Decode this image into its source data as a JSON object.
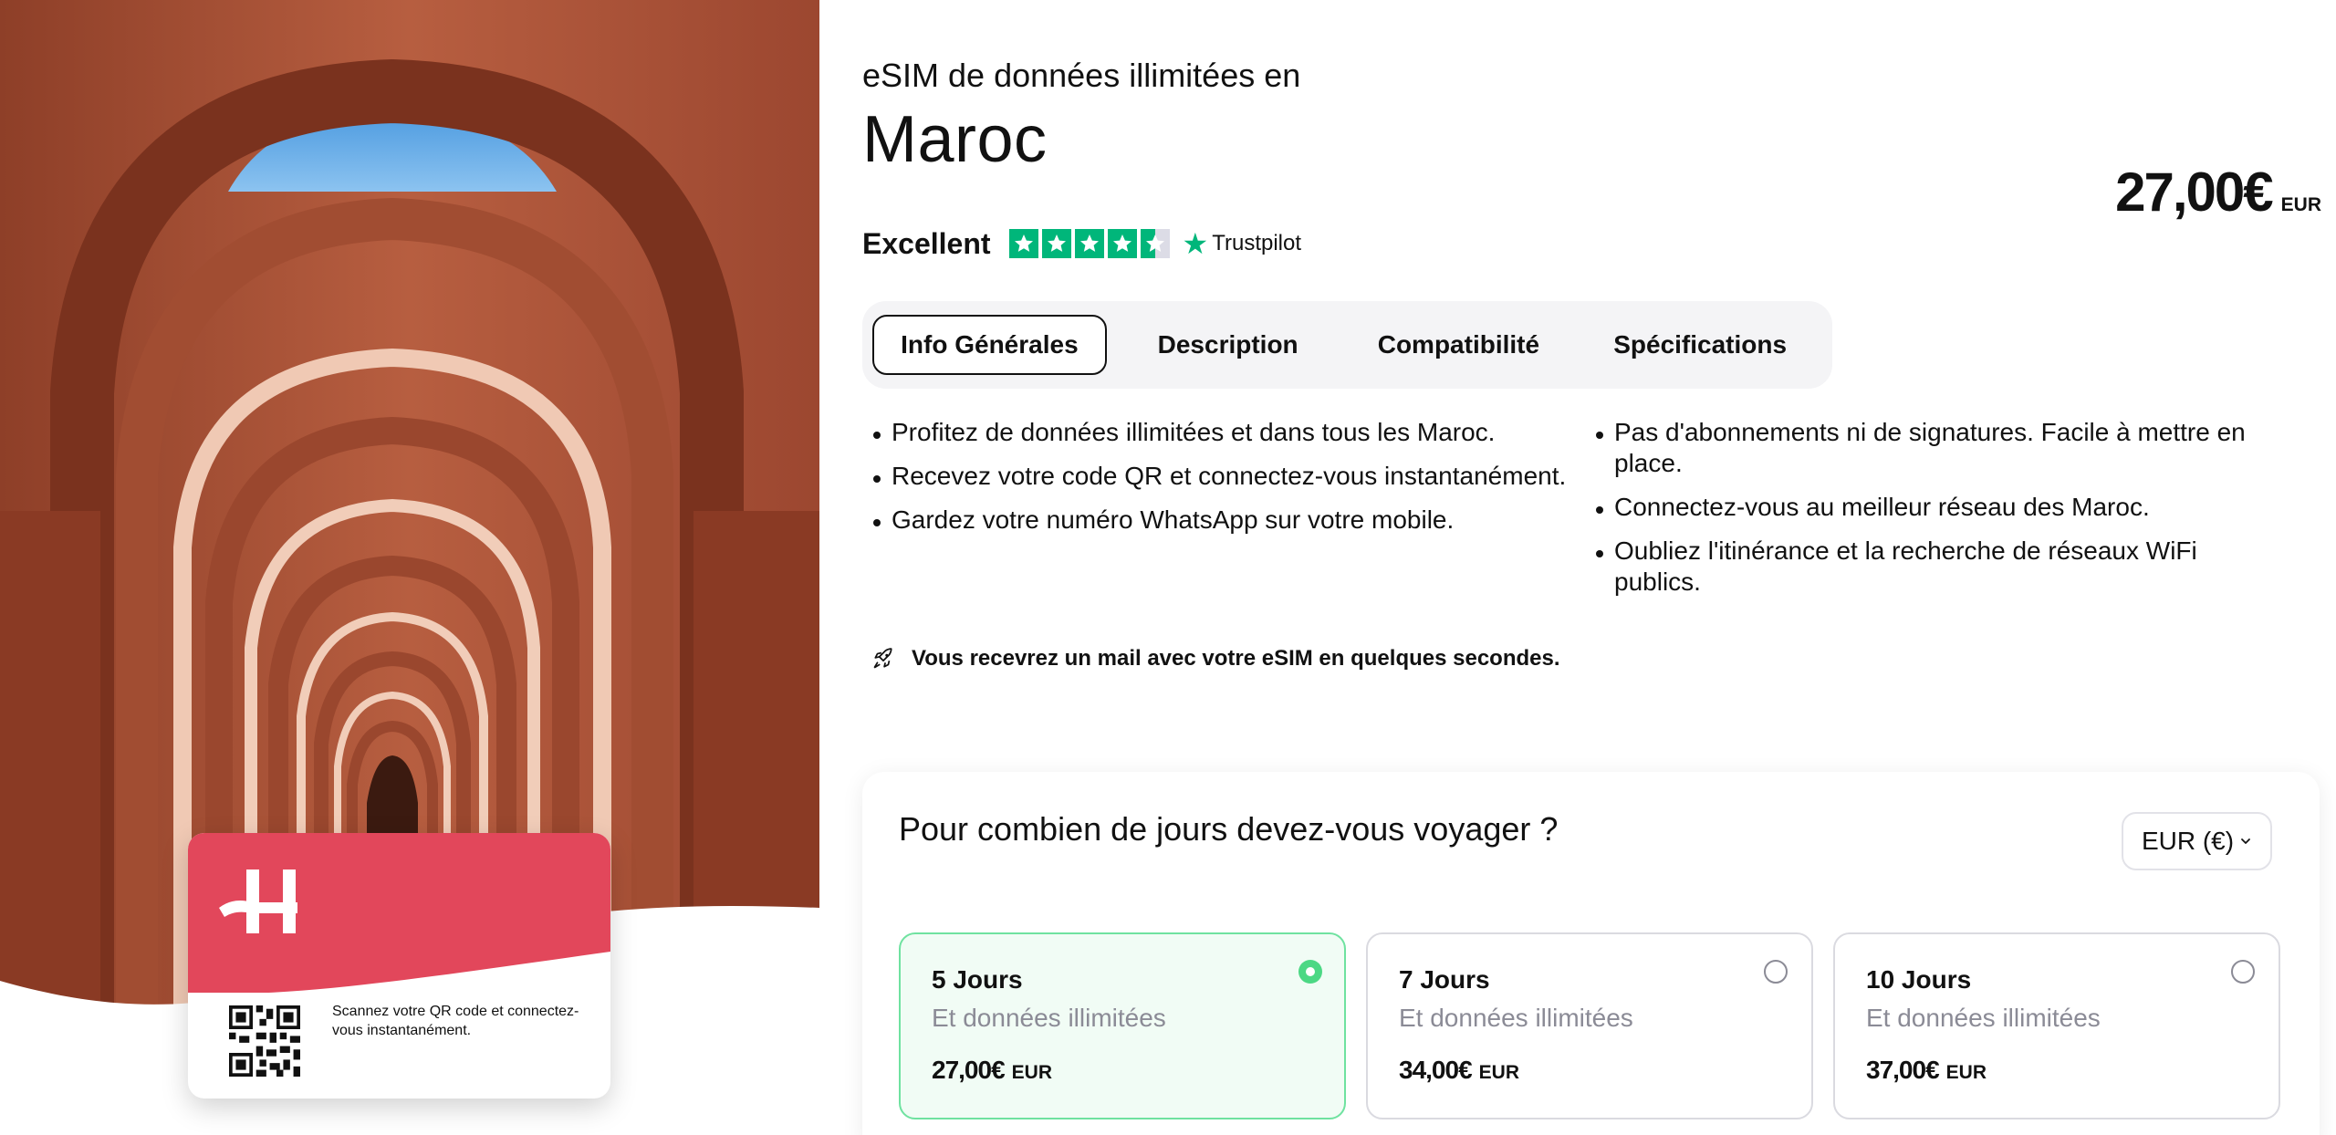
{
  "product": {
    "subtitle": "eSIM de données illimitées en",
    "title": "Maroc",
    "price": {
      "amount": "27,00€",
      "currency": "EUR"
    }
  },
  "rating": {
    "label": "Excellent",
    "stars": 4.5,
    "provider": "Trustpilot",
    "color": "#00b67a"
  },
  "tabs": [
    {
      "label": "Info Générales",
      "active": true
    },
    {
      "label": "Description",
      "active": false
    },
    {
      "label": "Compatibilité",
      "active": false
    },
    {
      "label": "Spécifications",
      "active": false
    }
  ],
  "features": {
    "left": [
      "Profitez de données illimitées et dans tous les Maroc.",
      "Recevez votre code QR et connectez-vous instantanément.",
      "Gardez votre numéro WhatsApp sur votre mobile."
    ],
    "right": [
      "Pas d'abonnements ni de signatures. Facile à mettre en place.",
      "Connectez-vous au meilleur réseau des Maroc.",
      "Oubliez l'itinérance et la recherche de réseaux WiFi publics."
    ]
  },
  "notice": {
    "icon": "rocket-icon",
    "text": "Vous recevrez un mail avec votre eSIM en quelques secondes."
  },
  "duration": {
    "question": "Pour combien de jours devez-vous voyager ?",
    "currency_select": "EUR (€)",
    "plans": [
      {
        "name": "5 Jours",
        "desc": "Et données illimitées",
        "price": "27,00€",
        "currency": "EUR",
        "selected": true
      },
      {
        "name": "7 Jours",
        "desc": "Et données illimitées",
        "price": "34,00€",
        "currency": "EUR",
        "selected": false
      },
      {
        "name": "10 Jours",
        "desc": "Et données illimitées",
        "price": "37,00€",
        "currency": "EUR",
        "selected": false
      }
    ]
  },
  "esim_card": {
    "qr_text": "Scannez votre QR code et connectez-vous instantanément.",
    "brand_color": "#e2475b"
  }
}
